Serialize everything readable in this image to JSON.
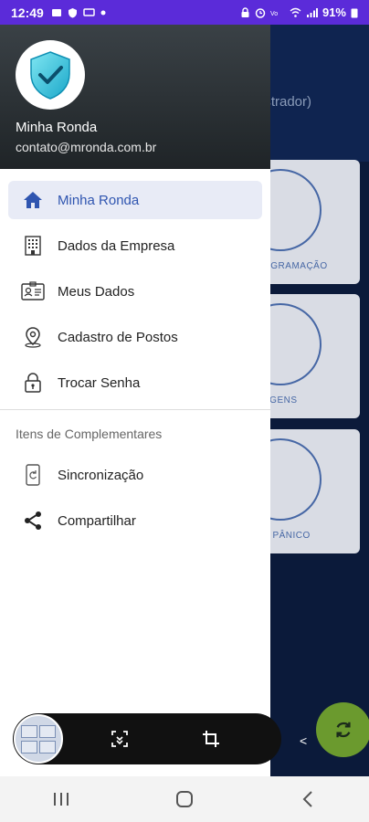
{
  "status_bar": {
    "time": "12:49",
    "battery": "91%",
    "left_icons": [
      "photo-icon",
      "shield-icon",
      "screen-icon",
      "dot-icon"
    ],
    "right_icons": [
      "lock-icon",
      "alarm-icon",
      "volte-icon",
      "wifi-icon",
      "signal-icon",
      "battery-icon"
    ]
  },
  "drawer": {
    "user_name": "Minha Ronda",
    "user_email": "contato@mronda.com.br",
    "items": [
      {
        "label": "Minha Ronda",
        "icon": "home-icon",
        "active": true
      },
      {
        "label": "Dados da Empresa",
        "icon": "building-icon",
        "active": false
      },
      {
        "label": "Meus Dados",
        "icon": "id-card-icon",
        "active": false
      },
      {
        "label": "Cadastro de Postos",
        "icon": "map-pin-icon",
        "active": false
      },
      {
        "label": "Trocar Senha",
        "icon": "lock-icon",
        "active": false
      }
    ],
    "section_title": "Itens de Complementares",
    "extra_items": [
      {
        "label": "Sincronização",
        "icon": "sync-device-icon"
      },
      {
        "label": "Compartilhar",
        "icon": "share-icon"
      }
    ]
  },
  "background": {
    "subtitle": "istrador)",
    "cards": [
      "OGRAMAÇÃO",
      "AGENS",
      "E PÂNICO"
    ]
  },
  "colors": {
    "status_bar": "#5b2bd9",
    "accent": "#2f55b0",
    "active_item_bg": "#e8ebf6",
    "refresh_button": "#6b9a2e"
  }
}
